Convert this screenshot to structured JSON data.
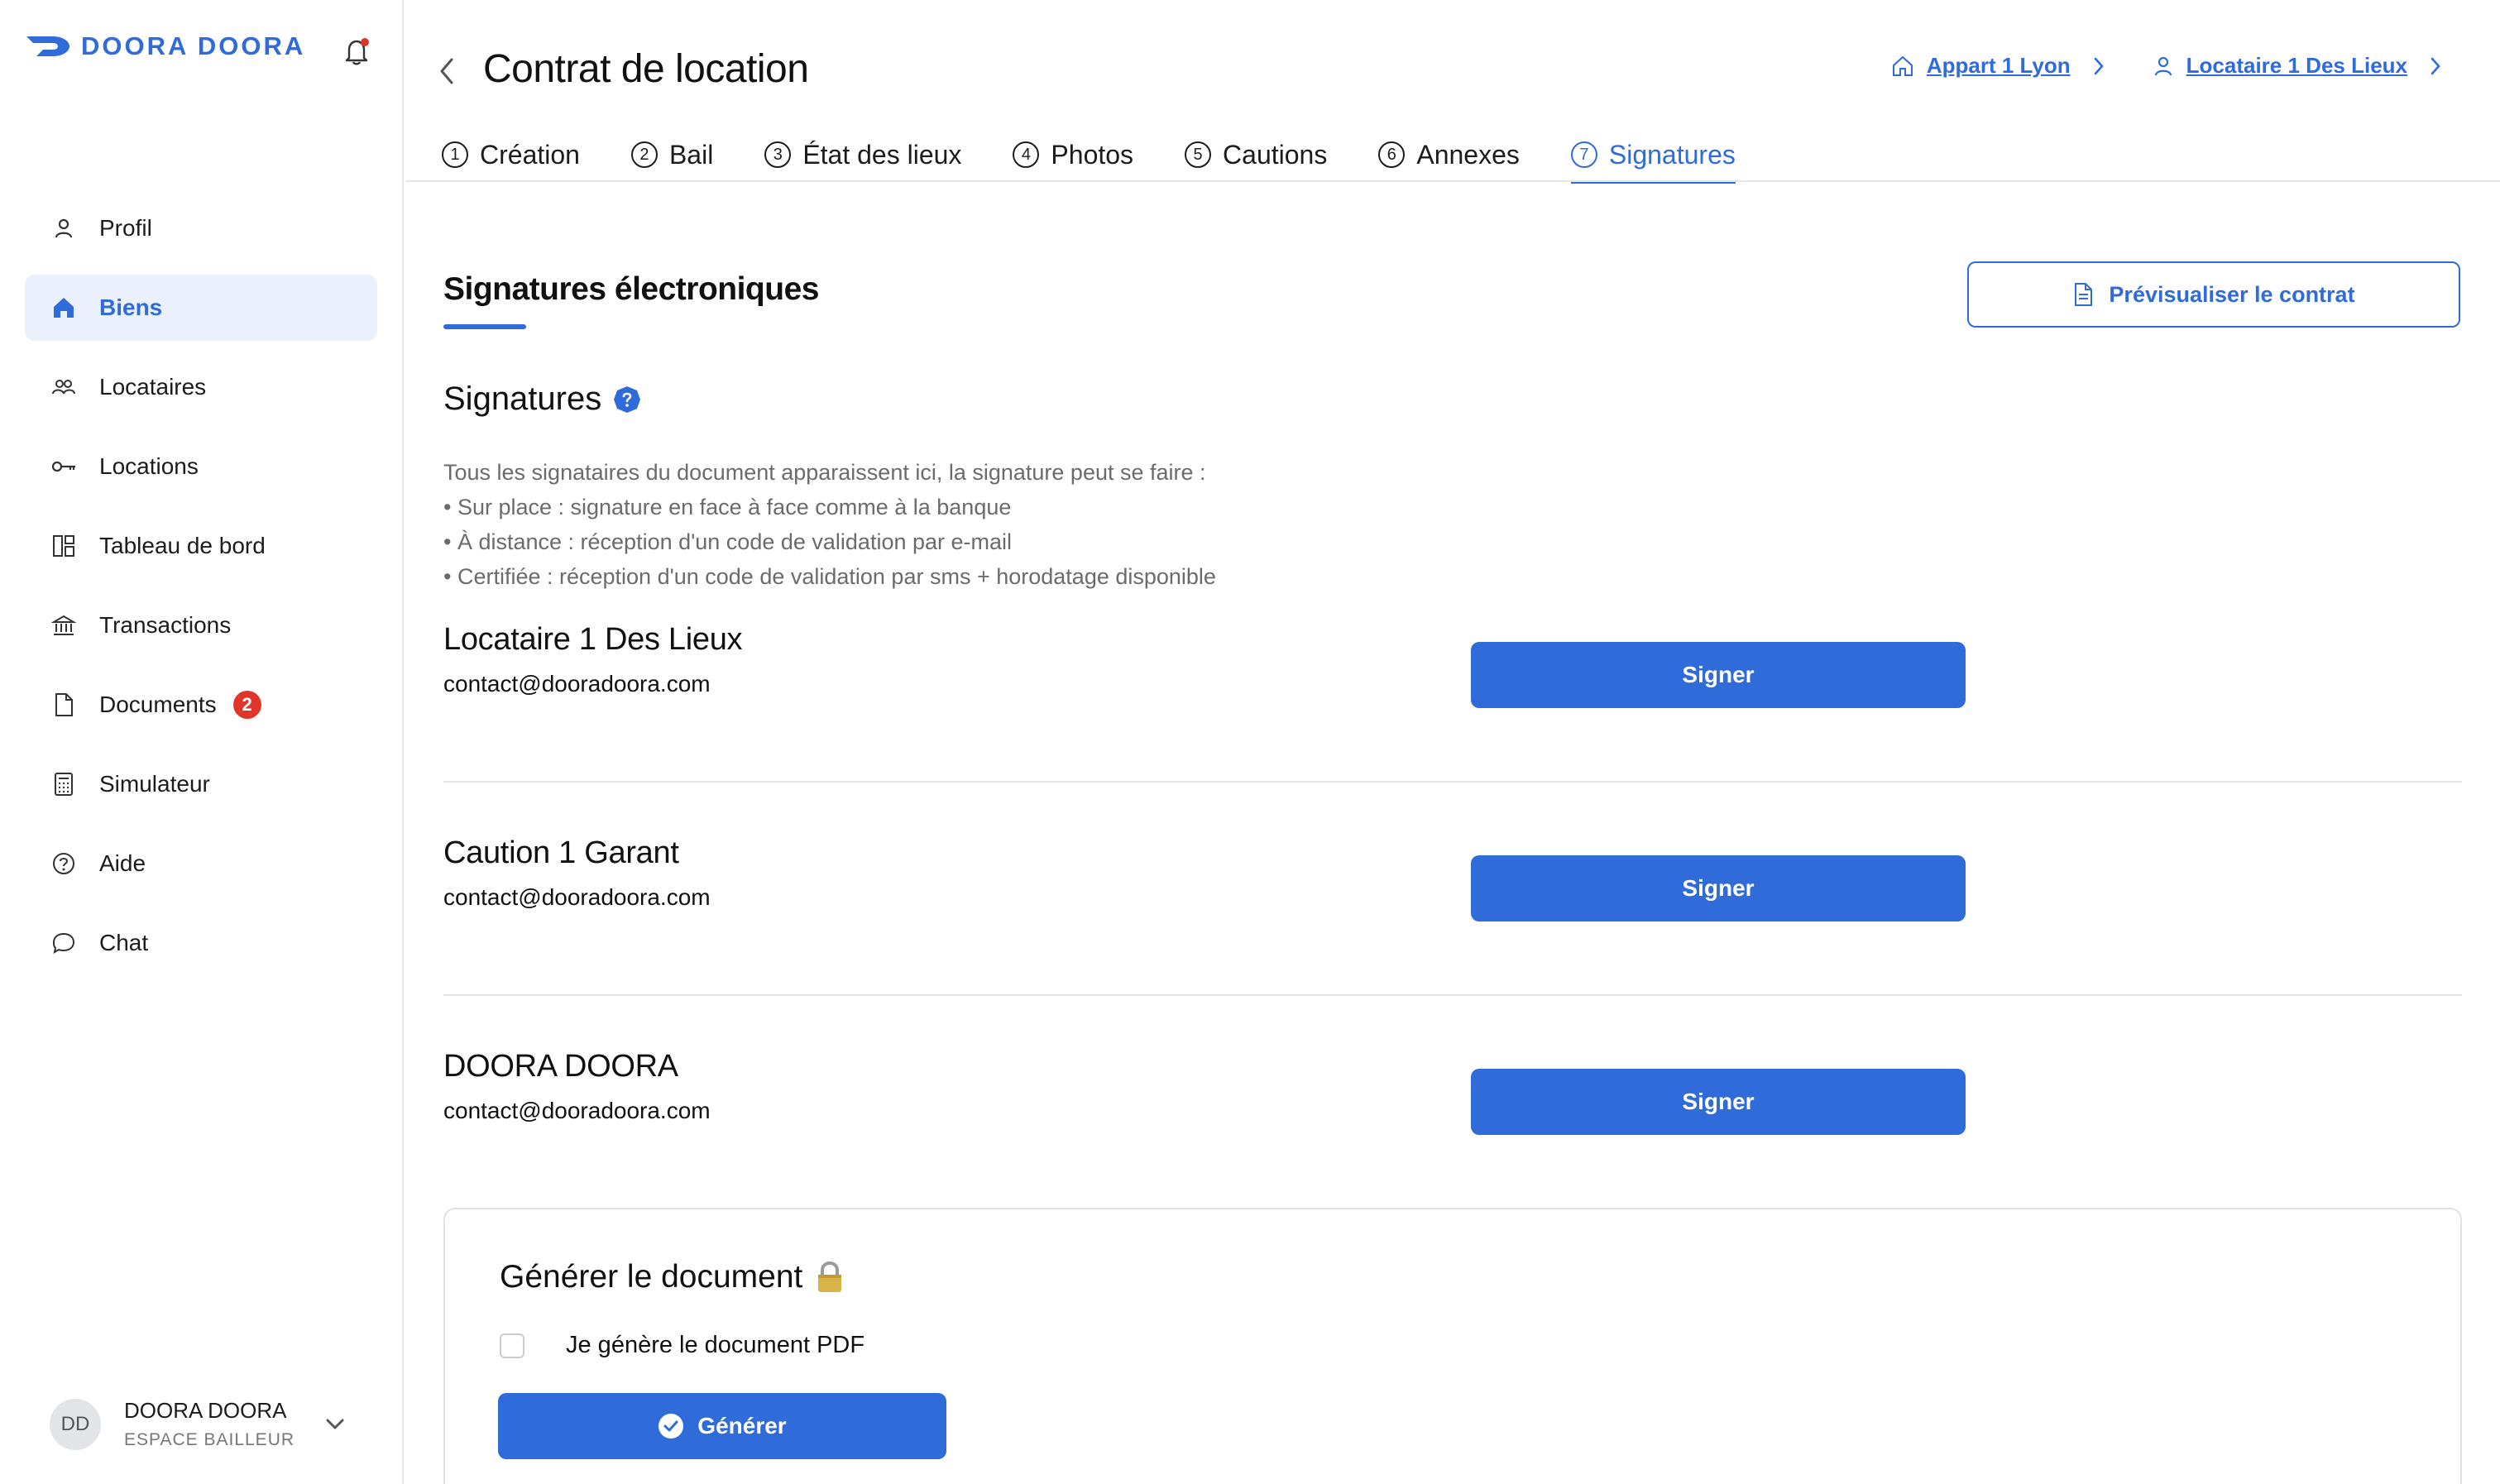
{
  "brand": {
    "name": "DOORA DOORA",
    "color": "#2f6bd9"
  },
  "sidebar": {
    "items": [
      {
        "label": "Profil",
        "icon": "user-icon"
      },
      {
        "label": "Biens",
        "icon": "home-icon",
        "active": true
      },
      {
        "label": "Locataires",
        "icon": "users-icon"
      },
      {
        "label": "Locations",
        "icon": "key-icon"
      },
      {
        "label": "Tableau de bord",
        "icon": "dashboard-icon"
      },
      {
        "label": "Transactions",
        "icon": "bank-icon"
      },
      {
        "label": "Documents",
        "icon": "document-icon",
        "badge": "2"
      },
      {
        "label": "Simulateur",
        "icon": "calculator-icon"
      },
      {
        "label": "Aide",
        "icon": "help-icon"
      },
      {
        "label": "Chat",
        "icon": "chat-icon"
      }
    ]
  },
  "user": {
    "initials": "DD",
    "name": "DOORA DOORA",
    "role": "ESPACE BAILLEUR"
  },
  "header": {
    "title": "Contrat de location",
    "breadcrumbs": [
      {
        "label": "Appart 1 Lyon",
        "icon": "home-icon"
      },
      {
        "label": "Locataire 1 Des Lieux",
        "icon": "user-icon"
      }
    ]
  },
  "tabs": [
    {
      "num": "1",
      "label": "Création"
    },
    {
      "num": "2",
      "label": "Bail"
    },
    {
      "num": "3",
      "label": "État des lieux"
    },
    {
      "num": "4",
      "label": "Photos"
    },
    {
      "num": "5",
      "label": "Cautions"
    },
    {
      "num": "6",
      "label": "Annexes"
    },
    {
      "num": "7",
      "label": "Signatures",
      "active": true
    }
  ],
  "main": {
    "section_title": "Signatures électroniques",
    "preview_label": "Prévisualiser le contrat",
    "signatures_title": "Signatures",
    "description": [
      "Tous les signataires du document apparaissent ici, la signature peut se faire :",
      "• Sur place : signature en face à face comme à la banque",
      "• À distance : réception d'un code de validation par e-mail",
      "• Certifiée : réception d'un code de validation par sms + horodatage disponible"
    ],
    "signers": [
      {
        "name": "Locataire 1 Des Lieux",
        "email": "contact@dooradoora.com",
        "button": "Signer"
      },
      {
        "name": "Caution 1 Garant",
        "email": "contact@dooradoora.com",
        "button": "Signer"
      },
      {
        "name": "DOORA DOORA",
        "email": "contact@dooradoora.com",
        "button": "Signer"
      }
    ],
    "generate": {
      "title": "Générer le document",
      "checkbox_label": "Je génère le document PDF",
      "checked": false,
      "button": "Générer"
    }
  }
}
